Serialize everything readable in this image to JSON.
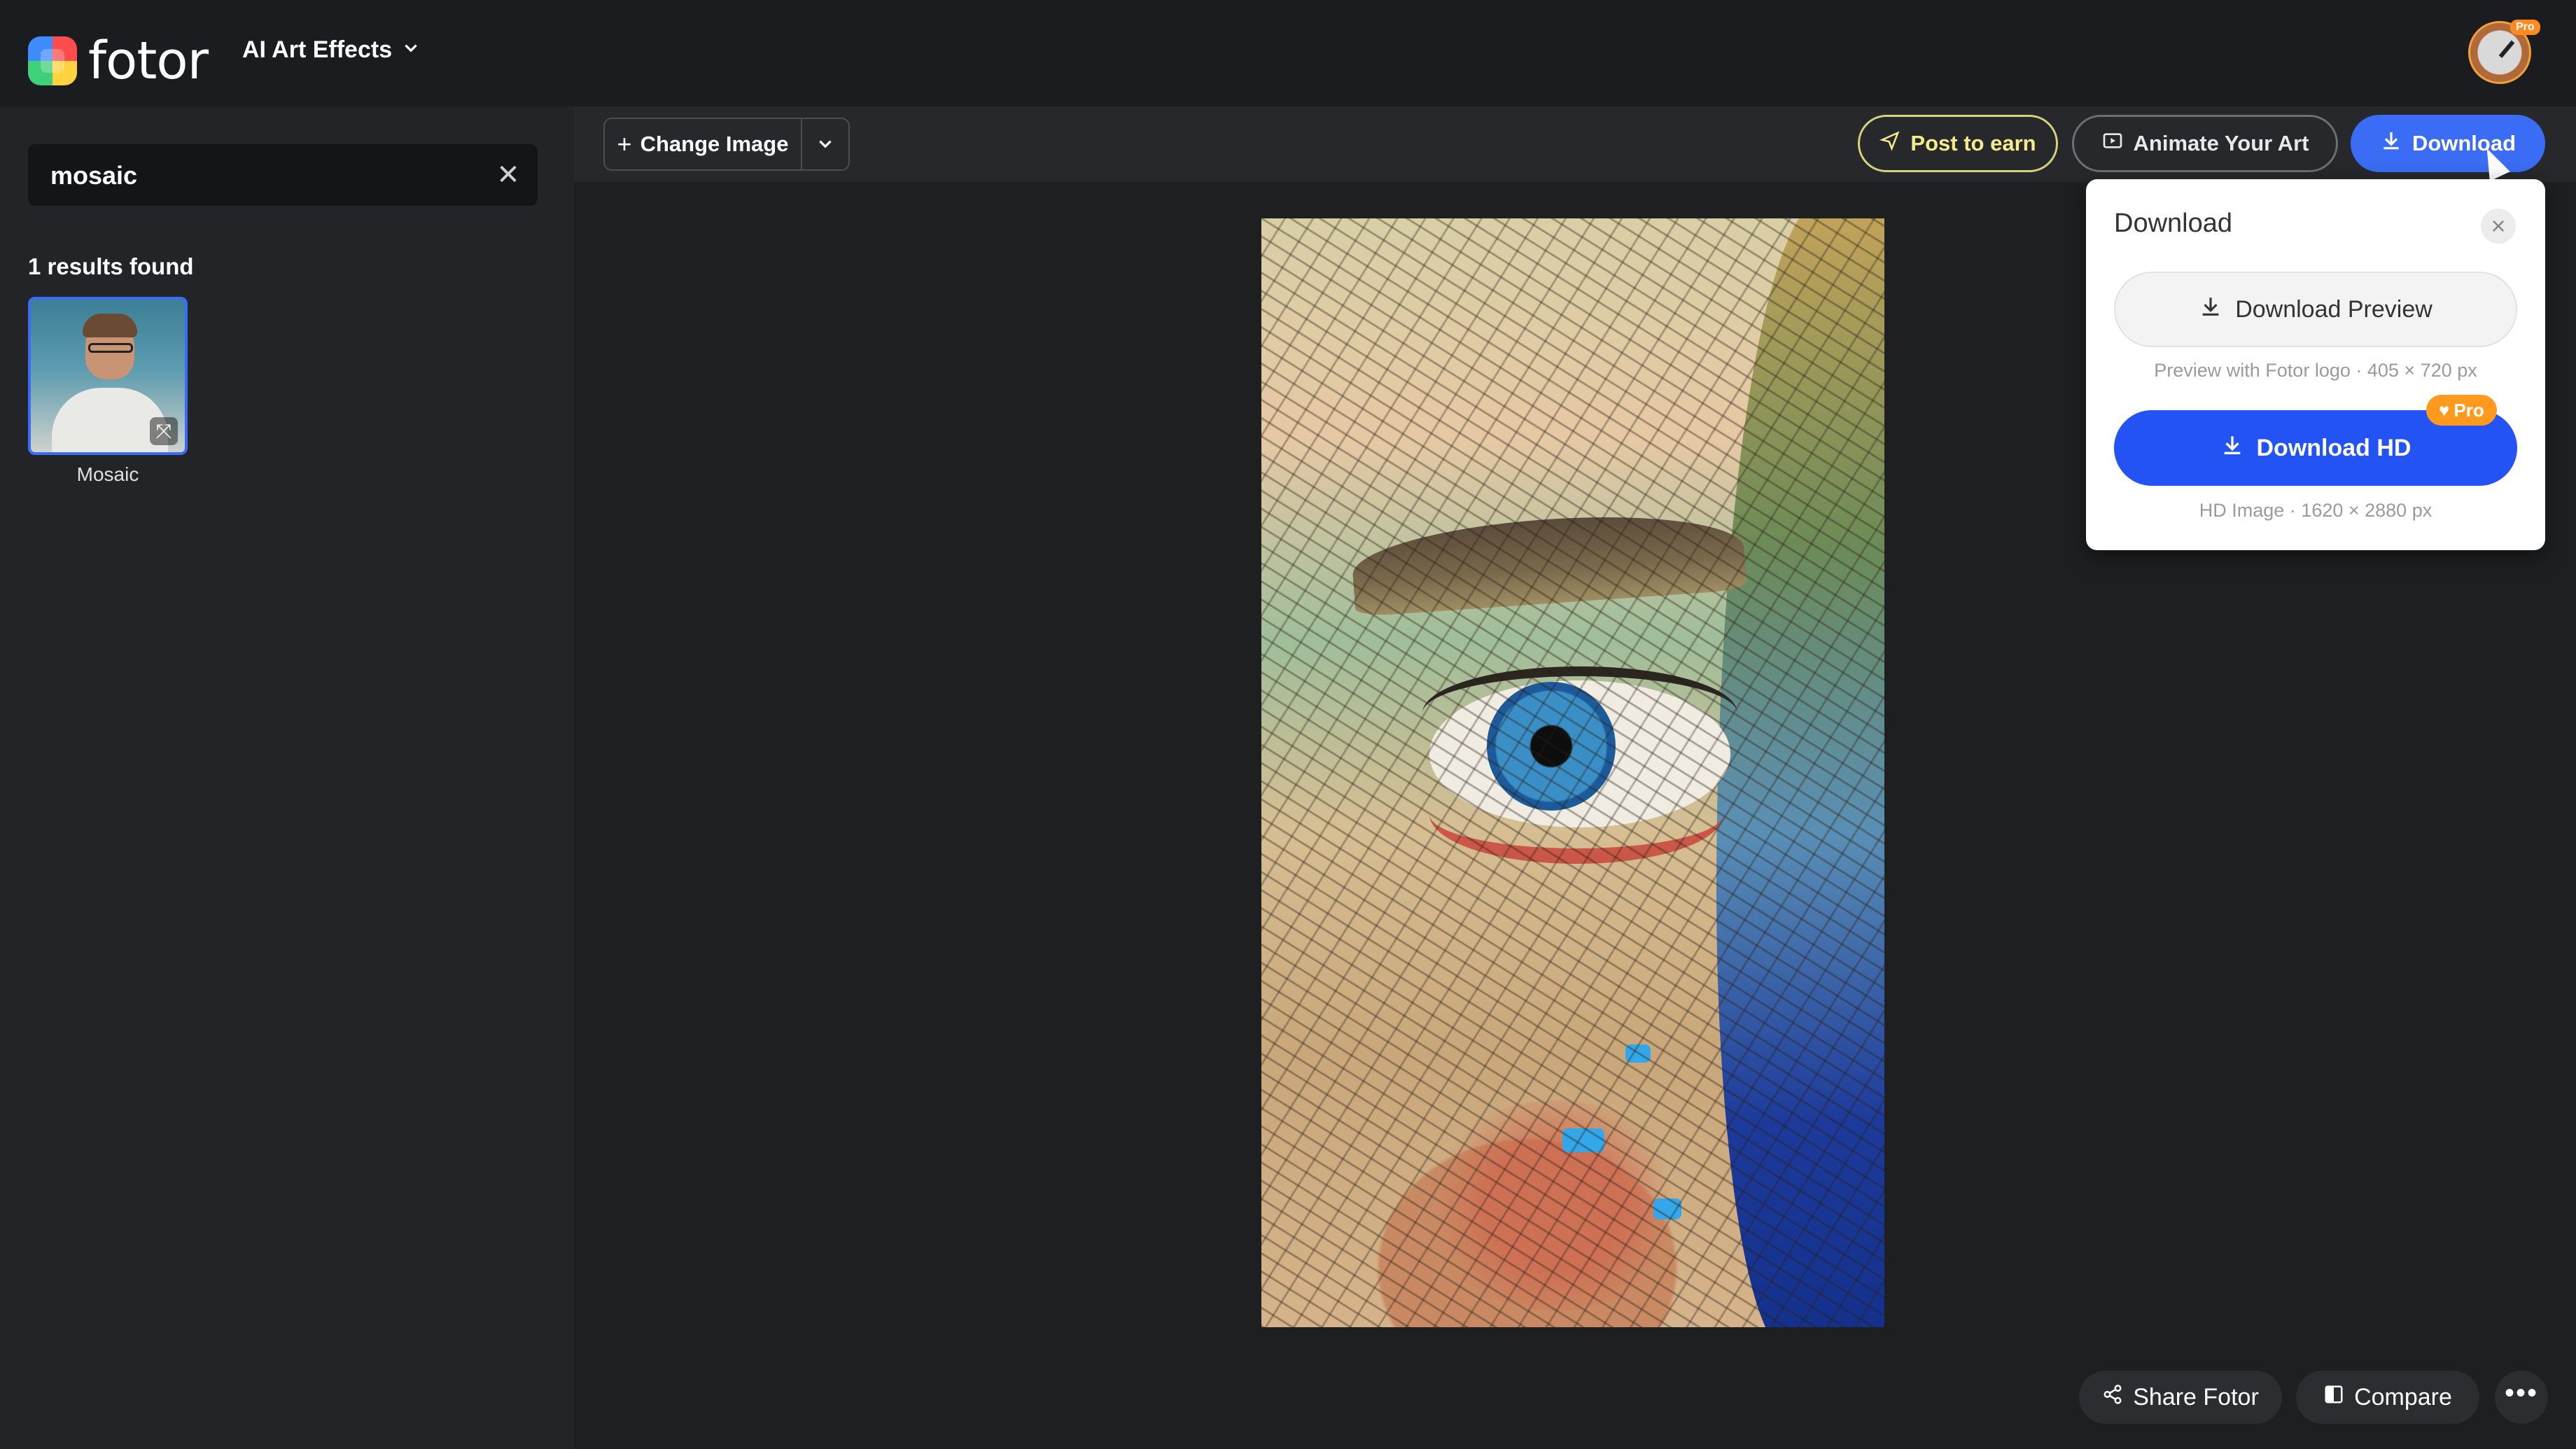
{
  "header": {
    "brand": "fotor",
    "nav_dropdown": "AI Art Effects",
    "avatar_badge": "Pro"
  },
  "sidebar": {
    "search_value": "mosaic",
    "results_count": "1 results found",
    "results": [
      {
        "label": "Mosaic"
      }
    ]
  },
  "toolbar": {
    "change_image": "Change Image",
    "post_to_earn": "Post to earn",
    "animate": "Animate Your Art",
    "download": "Download"
  },
  "download_popover": {
    "title": "Download",
    "preview_button": "Download Preview",
    "preview_note": "Preview with Fotor logo · 405 × 720 px",
    "hd_button": "Download HD",
    "hd_badge": "Pro",
    "hd_note": "HD Image · 1620 × 2880 px"
  },
  "bottom_controls": {
    "share": "Share Fotor",
    "compare": "Compare"
  },
  "colors": {
    "accent": "#3a6cf5",
    "hd_button": "#2352f5",
    "pro_badge": "#ff9a1f",
    "post_to_earn": "#d5d27a"
  },
  "icons": [
    "chevron-down-icon",
    "plus-icon",
    "send-icon",
    "animate-icon",
    "download-icon",
    "close-icon",
    "share-icon",
    "compare-icon",
    "more-icon",
    "crown-icon"
  ]
}
